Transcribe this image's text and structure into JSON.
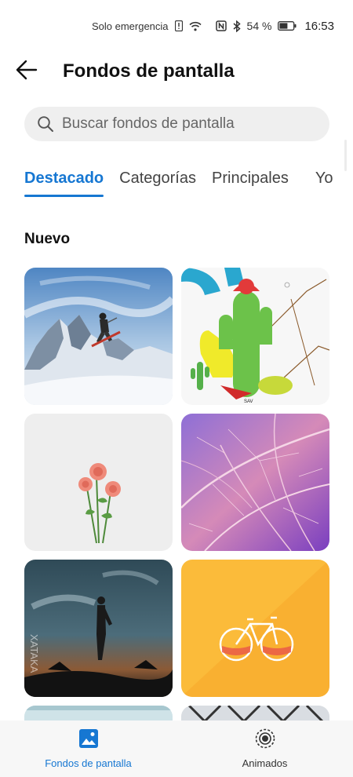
{
  "status_bar": {
    "emergency_text": "Solo emergencia",
    "battery_text": "54 %",
    "time": "16:53",
    "icons": [
      "sim-alert-icon",
      "wifi-icon",
      "nfc-icon",
      "bluetooth-icon",
      "battery-icon"
    ]
  },
  "header": {
    "title": "Fondos de pantalla",
    "back_icon": "arrow-left-icon"
  },
  "search": {
    "placeholder": "Buscar fondos de pantalla",
    "value": "",
    "icon": "search-icon"
  },
  "tabs": [
    {
      "label": "Destacado",
      "active": true
    },
    {
      "label": "Categorías",
      "active": false
    },
    {
      "label": "Principales",
      "active": false
    },
    {
      "label": "Yo",
      "active": false
    }
  ],
  "section": {
    "title": "Nuevo"
  },
  "wallpapers": [
    {
      "name": "skier-mountain"
    },
    {
      "name": "cactus-art"
    },
    {
      "name": "pink-roses"
    },
    {
      "name": "purple-leaf"
    },
    {
      "name": "moon-silhouette"
    },
    {
      "name": "bicycle-yellow"
    }
  ],
  "bottom_nav": [
    {
      "label": "Fondos de pantalla",
      "icon": "image-icon",
      "active": true
    },
    {
      "label": "Animados",
      "icon": "live-wallpaper-icon",
      "active": false
    }
  ],
  "colors": {
    "accent": "#1677d2"
  }
}
